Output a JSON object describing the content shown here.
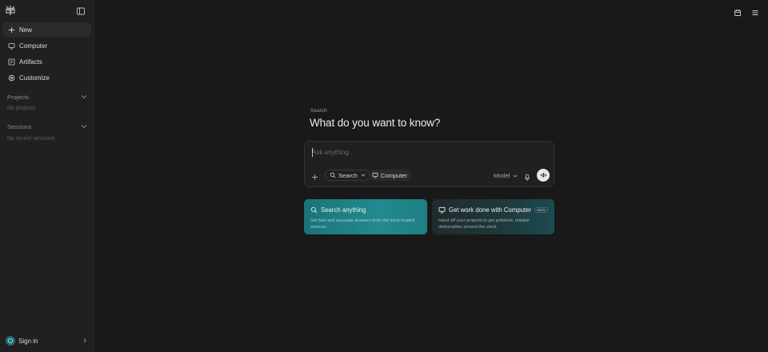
{
  "sidebar": {
    "logo": "perplexity-logo",
    "collapse_icon": "sidebar-collapse-icon",
    "nav": [
      {
        "label": "New",
        "icon": "plus-icon"
      },
      {
        "label": "Computer",
        "icon": "monitor-icon"
      },
      {
        "label": "Artifacts",
        "icon": "artifacts-icon"
      },
      {
        "label": "Customize",
        "icon": "settings-icon"
      }
    ],
    "projects": {
      "heading": "Projects",
      "empty": "No projects"
    },
    "sessions": {
      "heading": "Sessions",
      "empty": "No recent sessions"
    },
    "signin": {
      "label": "Sign in"
    }
  },
  "topbar": {
    "icons": [
      "calendar-icon",
      "menu-icon"
    ]
  },
  "main": {
    "kicker": "Search",
    "headline": "What do you want to know?",
    "composer": {
      "placeholder": "Ask anything...",
      "search_chip": "Search",
      "computer_chip": "Computer",
      "model_label": "Model"
    },
    "cards": [
      {
        "title": "Search anything",
        "description": "Get fast and accurate answers from the most trusted sources."
      },
      {
        "title": "Get work done with Computer",
        "badge": "NEW",
        "description": "Hand off your projects to get polished, reliable deliverables around the clock."
      }
    ]
  },
  "colors": {
    "accent": "#228a8f",
    "background": "#191919",
    "sidebar": "#202020"
  }
}
